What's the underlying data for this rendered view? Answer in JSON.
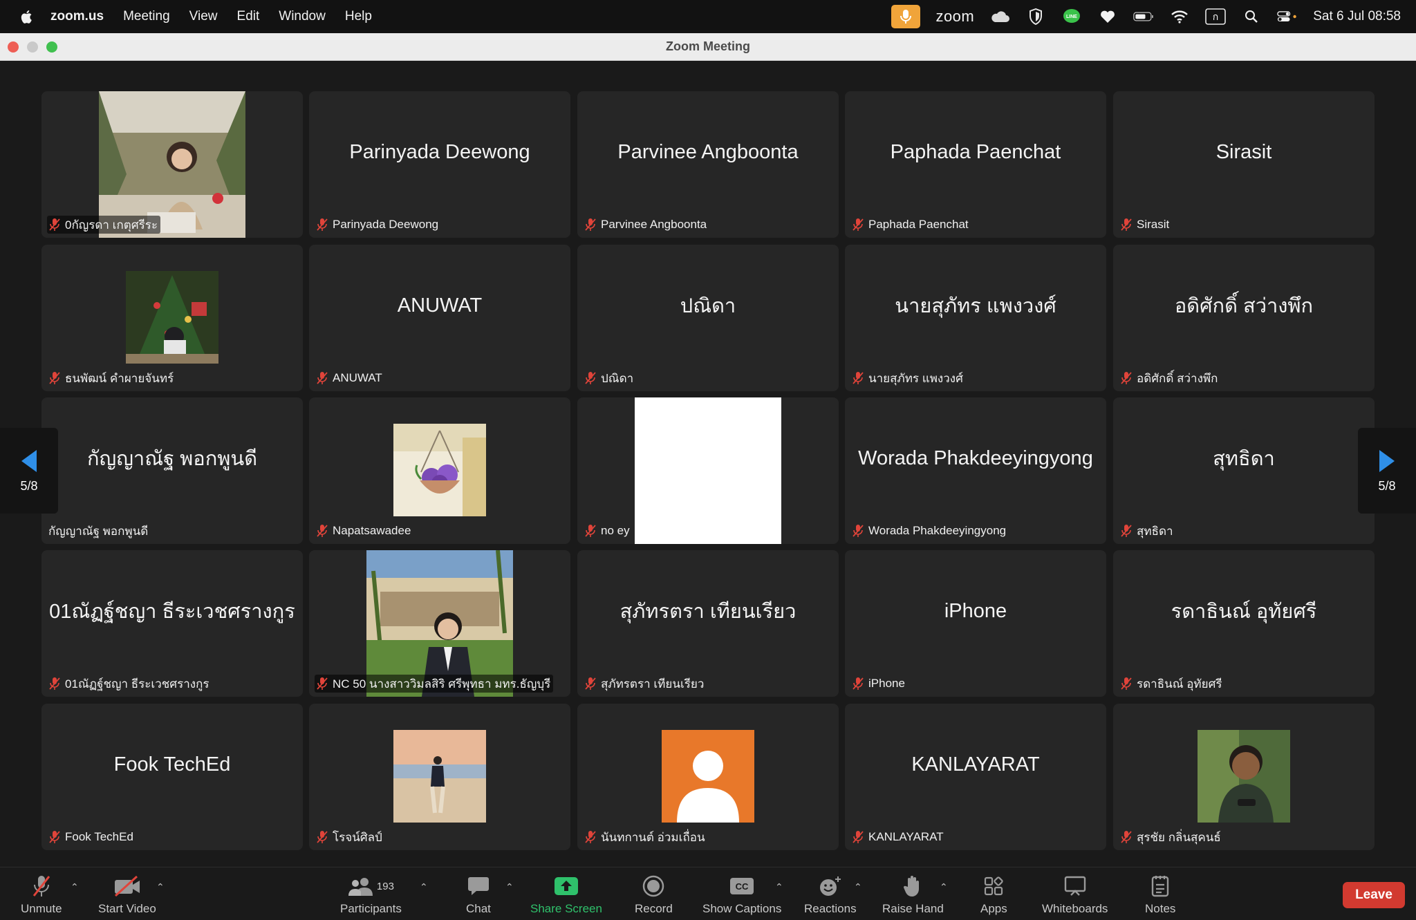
{
  "menubar": {
    "app_name": "zoom.us",
    "menus": [
      "Meeting",
      "View",
      "Edit",
      "Window",
      "Help"
    ],
    "zoom_brand": "zoom",
    "datetime": "Sat 6 Jul  08:58",
    "input_indicator": "ก"
  },
  "window": {
    "title": "Zoom Meeting"
  },
  "gallery": {
    "page_indicator": "5/8",
    "tiles": [
      {
        "name": "0กัญรดา เกตุศรีระ",
        "display": "",
        "video": "photo-woman-garden"
      },
      {
        "name": "Parinyada Deewong",
        "display": "Parinyada Deewong"
      },
      {
        "name": "Parvinee Angboonta",
        "display": "Parvinee Angboonta"
      },
      {
        "name": "Paphada Paenchat",
        "display": "Paphada Paenchat"
      },
      {
        "name": "Sirasit",
        "display": "Sirasit"
      },
      {
        "name": "ธนพัฒน์ คำผายจันทร์",
        "display": "",
        "video": "photo-christmas-tree"
      },
      {
        "name": "ANUWAT",
        "display": "ANUWAT"
      },
      {
        "name": "ปณิดา",
        "display": "ปณิดา"
      },
      {
        "name": "นายสุภัทร แพงวงศ์",
        "display": "นายสุภัทร แพงวงศ์"
      },
      {
        "name": "อดิศักดิ์ สว่างพึก",
        "display": "อดิศักดิ์ สว่างพึก"
      },
      {
        "name": "กัญญาณัฐ พอกพูนดี",
        "display": "กัญญาณัฐ พอกพูนดี",
        "muted": false
      },
      {
        "name": "Napatsawadee",
        "display": "",
        "video": "photo-flower-basket"
      },
      {
        "name": "no ey",
        "display": "",
        "video": "white-frame"
      },
      {
        "name": "Worada Phakdeeyingyong",
        "display": "Worada Phakdeeyingyong"
      },
      {
        "name": "สุทธิดา",
        "display": "สุทธิดา"
      },
      {
        "name": "01ณัฏฐ์ชญา ธีระเวชศรางกูร",
        "display": "01ณัฏฐ์ชญา ธีระเวชศรางกูร"
      },
      {
        "name": "NC 50 นางสาววิมลสิริ ศรีพุทธา มทร.ธัญบุรี",
        "display": "",
        "video": "photo-student-suit"
      },
      {
        "name": "สุภัทรตรา เทียนเรียว",
        "display": "สุภัทรตรา เทียนเรียว"
      },
      {
        "name": "iPhone",
        "display": "iPhone"
      },
      {
        "name": "รดาธินณ์ อุทัยศรี",
        "display": "รดาธินณ์ อุทัยศรี"
      },
      {
        "name": "Fook TechEd",
        "display": "Fook TechEd"
      },
      {
        "name": "โรจน์ศิลป์",
        "display": "",
        "video": "photo-beach"
      },
      {
        "name": "นันทกานต์ อ่วมเถื่อน",
        "display": "",
        "video": "avatar-placeholder-orange"
      },
      {
        "name": "KANLAYARAT",
        "display": "KANLAYARAT"
      },
      {
        "name": "สุรชัย กลิ่นสุคนธ์",
        "display": "",
        "video": "photo-man-portrait"
      }
    ]
  },
  "toolbar": {
    "unmute": "Unmute",
    "start_video": "Start Video",
    "participants": "Participants",
    "participants_count": "193",
    "chat": "Chat",
    "share_screen": "Share Screen",
    "record": "Record",
    "show_captions": "Show Captions",
    "captions_badge": "CC",
    "reactions": "Reactions",
    "raise_hand": "Raise Hand",
    "apps": "Apps",
    "whiteboards": "Whiteboards",
    "notes": "Notes",
    "leave": "Leave"
  },
  "colors": {
    "menubar_bg": "#121212",
    "tile_bg": "#262626",
    "muted_mic": "#e0443a",
    "share_green": "#2fc16b",
    "leave_red": "#d23a30",
    "nav_blue": "#2f8fe8",
    "avatar_orange": "#e8782a"
  }
}
